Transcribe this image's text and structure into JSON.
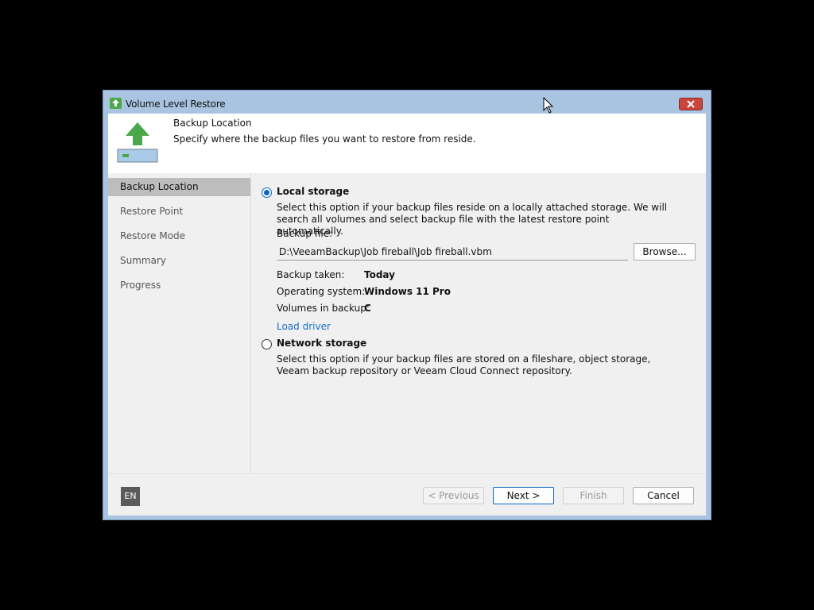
{
  "window": {
    "title": "Volume Level Restore"
  },
  "header": {
    "title": "Backup Location",
    "description": "Specify where the backup files you want to restore from reside."
  },
  "nav": {
    "items": [
      {
        "label": "Backup Location",
        "active": true
      },
      {
        "label": "Restore Point",
        "active": false
      },
      {
        "label": "Restore Mode",
        "active": false
      },
      {
        "label": "Summary",
        "active": false
      },
      {
        "label": "Progress",
        "active": false
      }
    ]
  },
  "local": {
    "label": "Local storage",
    "selected": true,
    "description": "Select this option if your backup files reside on a locally attached storage. We will search all volumes and select backup file with the latest restore point automatically.",
    "backup_file_label": "Backup file:",
    "backup_file_value": "D:\\VeeamBackup\\Job fireball\\Job fireball.vbm",
    "browse_label": "Browse...",
    "backup_taken_label": "Backup taken:",
    "backup_taken_value": "Today",
    "os_label": "Operating system:",
    "os_value": "Windows 11 Pro",
    "volumes_label": "Volumes in backup:",
    "volumes_value": "C",
    "load_driver": "Load driver"
  },
  "network": {
    "label": "Network storage",
    "selected": false,
    "description": "Select this option if your backup files are stored on a fileshare, object storage, Veeam backup repository or Veeam Cloud Connect repository."
  },
  "footer": {
    "language": "EN",
    "previous": "< Previous",
    "next": "Next >",
    "finish": "Finish",
    "cancel": "Cancel"
  },
  "colors": {
    "titlebar": "#a9c4e0",
    "accent": "#0a64c8",
    "link": "#1a6fc4",
    "close": "#c9463d",
    "icon_green": "#4aa84a"
  }
}
